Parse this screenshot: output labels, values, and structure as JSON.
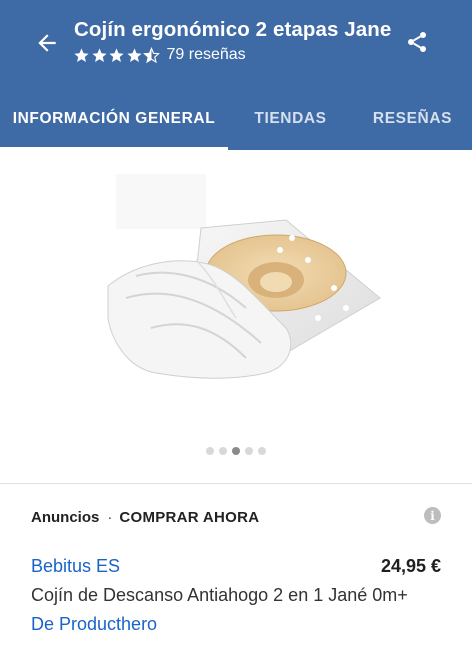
{
  "app_bar": {
    "title": "Cojín ergonómico 2 etapas Jane",
    "rating": 4.5,
    "reviews_label": "79 reseñas",
    "back_icon": "arrow-back-icon",
    "share_icon": "share-icon"
  },
  "tabs": [
    {
      "label": "INFORMACIÓN GENERAL",
      "active": true
    },
    {
      "label": "TIENDAS",
      "active": false
    },
    {
      "label": "RESEÑAS",
      "active": false
    }
  ],
  "gallery": {
    "image": "cushion-product-image",
    "dot_count": 5,
    "active_dot": 3
  },
  "ads": {
    "label": "Anuncios",
    "separator": "·",
    "buy_label": "COMPRAR AHORA",
    "info_icon": "info-icon"
  },
  "offer": {
    "store": "Bebitus ES",
    "price": "24,95 €",
    "description": "Cojín de Descanso Antiahogo 2 en 1 Jané 0m+",
    "seller": "De Producthero"
  },
  "colors": {
    "primary": "#3e6aa6",
    "link": "#1a63c7",
    "text": "#333333"
  }
}
